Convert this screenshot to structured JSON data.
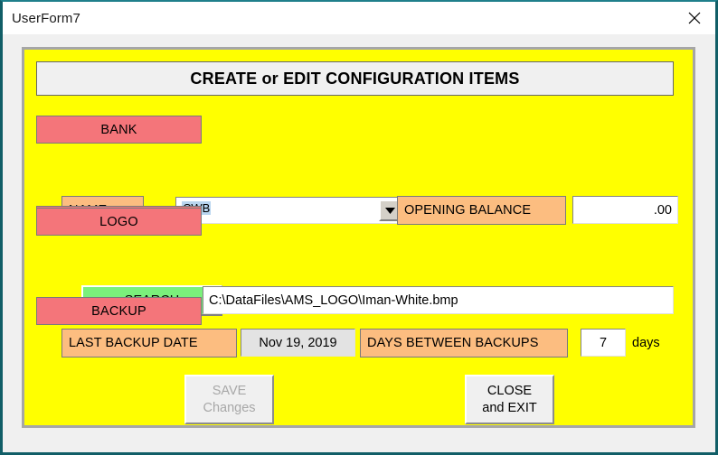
{
  "window": {
    "title": "UserForm7",
    "close_icon": "close-icon"
  },
  "form": {
    "header": "CREATE or EDIT CONFIGURATION ITEMS",
    "sections": {
      "bank": {
        "title": "BANK",
        "name_label": "NAME",
        "name_value": "CWB",
        "dropdown_icon": "chevron-down-icon",
        "opening_balance_label": "OPENING BALANCE",
        "opening_balance_value": ".00"
      },
      "logo": {
        "title": "LOGO",
        "search_label": "SEARCH",
        "path_value": "C:\\DataFiles\\AMS_LOGO\\Iman-White.bmp"
      },
      "backup": {
        "title": "BACKUP",
        "last_backup_label": "LAST BACKUP DATE",
        "last_backup_value": "Nov 19, 2019",
        "days_between_label": "DAYS BETWEEN BACKUPS",
        "days_between_value": "7",
        "days_suffix": "days"
      }
    },
    "buttons": {
      "save_line1": "SAVE",
      "save_line2": "Changes",
      "close_line1": "CLOSE",
      "close_line2": "and EXIT"
    }
  },
  "colors": {
    "form_background": "#ffff00",
    "section_title": "#f4757a",
    "field_label": "#fcbd80",
    "search_button": "#7bf07b",
    "window_border": "#115e67",
    "selection_highlight": "#b8d5ef"
  }
}
